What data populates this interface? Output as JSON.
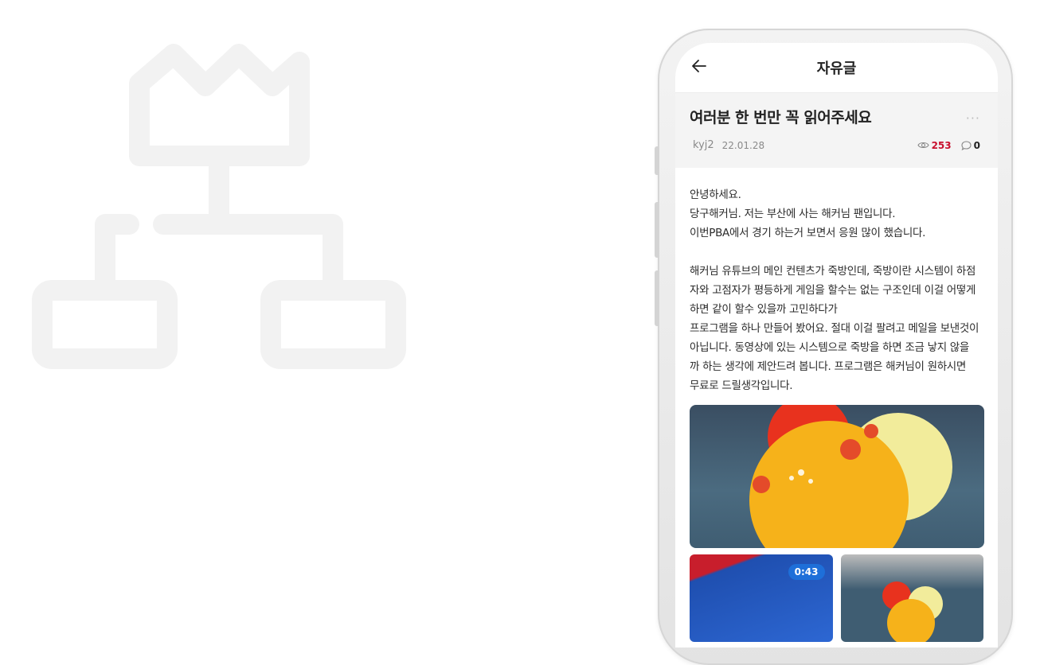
{
  "header": {
    "title": "자유글"
  },
  "post": {
    "title": "여러분 한 번만 꼭 읽어주세요",
    "more_label": "···",
    "author": "kyj2",
    "date": "22.01.28",
    "views": "253",
    "comments": "0",
    "paragraphs": [
      [
        "안녕하세요.",
        "당구해커님. 저는 부산에 사는 해커님 팬입니다.",
        "이번PBA에서 경기 하는거 보면서 응원 많이 했습니다."
      ],
      [
        "해커님 유튜브의 메인 컨텐츠가 죽방인데, 죽방이란 시스템이 하점",
        "자와 고점자가 평등하게 게임을 할수는 없는 구조인데 이걸 어떻게",
        "하면 같이 할수 있을까 고민하다가",
        "프로그램을 하나 만들어 봤어요. 절대 이걸 팔려고 메일을 보낸것이",
        " 아닙니다. 동영상에 있는 시스템으로 죽방을 하면 조금 낳지 않을",
        "까 하는 생각에 제안드려 봅니다. 프로그램은 해커님이 원하시면",
        "무료로 드릴생각입니다."
      ]
    ],
    "video_duration": "0:43"
  },
  "icons": {
    "back": "arrow-left-icon",
    "views": "eye-icon",
    "comments": "speech-bubble-icon",
    "more": "more-dots-icon"
  },
  "colors": {
    "views_accent": "#c8102e",
    "badge": "#1e6fd9",
    "meta_bg": "#f4f4f4"
  }
}
